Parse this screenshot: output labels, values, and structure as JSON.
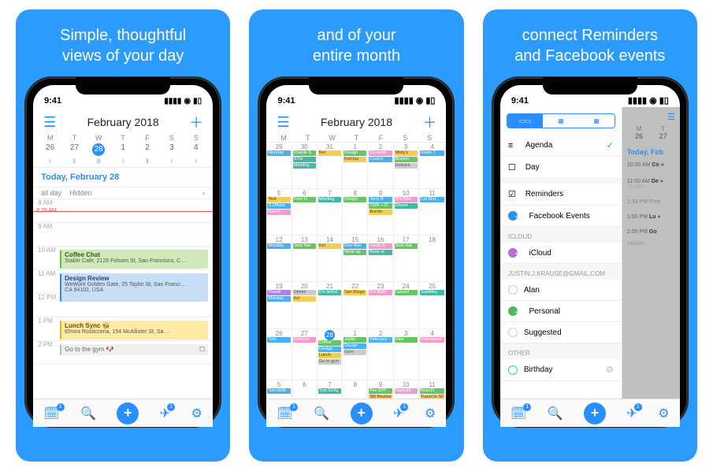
{
  "status": {
    "time": "9:41"
  },
  "captions": {
    "p1l1": "Simple, thoughtful",
    "p1l2": "views of your day",
    "p2l1": "and of your",
    "p2l2": "entire month",
    "p3l1": "connect Reminders",
    "p3l2": "and Facebook events"
  },
  "header": {
    "title": "February 2018",
    "weekdays": [
      "M",
      "T",
      "W",
      "T",
      "F",
      "S",
      "S"
    ],
    "daynums": [
      "26",
      "27",
      "28",
      "1",
      "2",
      "3",
      "4"
    ]
  },
  "day": {
    "today_label": "Today,",
    "today_date": "February 28",
    "allday_label": "all day",
    "allday_value": "Hidden",
    "hours": [
      "8 AM",
      "9 AM",
      "10 AM",
      "11 AM",
      "12 PM",
      "1 PM",
      "2 PM"
    ],
    "nowtime": "8:29 AM",
    "events": {
      "coffee": {
        "title": "Coffee Chat",
        "loc": "Stable Cafe, 2128 Folsom St, San Francisco, C…"
      },
      "design": {
        "title": "Design Review",
        "loc": "WeWork Golden Gate, 25 Taylor St, San Franci…"
      },
      "design2": "CA 94102, USA",
      "lunch": {
        "title": "Lunch Sync 🐝",
        "loc": "Elmira Rosticceria, 154 McAllister St, Sa…"
      },
      "gym": "Go to the gym 🐶"
    }
  },
  "month": {
    "weeks": [
      {
        "days": [
          "29",
          "30",
          "31",
          "1",
          "2",
          "3",
          "4"
        ]
      },
      {
        "days": [
          "5",
          "6",
          "7",
          "8",
          "9",
          "10",
          "11"
        ]
      },
      {
        "days": [
          "12",
          "13",
          "14",
          "15",
          "16",
          "17",
          "18"
        ]
      },
      {
        "days": [
          "19",
          "20",
          "21",
          "22",
          "23",
          "24",
          "25"
        ]
      },
      {
        "days": [
          "26",
          "27",
          "28",
          "1",
          "2",
          "3",
          "4"
        ]
      },
      {
        "days": [
          "5",
          "6",
          "7",
          "8",
          "9",
          "10",
          "11"
        ]
      }
    ],
    "sample_chips": {
      "c1": "Monday",
      "c2": "Charlie S",
      "c3": "Dinner",
      "c4": "Meeting",
      "c5": "Design",
      "c6": "Jerry B",
      "c7": "Brunch",
      "c8": "Lunch",
      "c9": "Coffee",
      "c10": "February",
      "c11": "Hike",
      "c12": "Free Agent",
      "c13": "TGIF + D",
      "c14": "Team Offsite",
      "c15": "Burrito",
      "c16": "SR Review",
      "c17": "Pre-SVP",
      "c18": "Book of",
      "c19": "Lunar N",
      "c20": "Justin T",
      "c21": "Daylight",
      "c22": "Subtitles",
      "c23": "Lunch!!",
      "c24": "Travel to SF",
      "c25": "San Diego"
    }
  },
  "drawer": {
    "agenda": "Agenda",
    "day": "Day",
    "reminders": "Reminders",
    "fb": "Facebook Events",
    "sect_icloud": "ICLOUD",
    "icloud": "iCloud",
    "sect_account": "JUSTIN.J.KRAUSE@GMAIL.COM",
    "alan": "Alan",
    "personal": "Personal",
    "suggested": "Suggested",
    "sect_other": "OTHER",
    "birthday": "Birthday"
  },
  "bg_day": {
    "daterow": [
      "M",
      "T"
    ],
    "daynums": [
      "26",
      "27"
    ],
    "today_lbl": "Today, Feb",
    "r1t": "10:00 AM",
    "r1": "Co",
    "r2t": "11:00 AM",
    "r2": "De",
    "r2d": "1h 30m",
    "r3t": "1:30 PM",
    "r3": "Free",
    "r4t": "1:00 PM",
    "r4": "Lu",
    "r5t": "2:00 PM",
    "r5": "Go",
    "r6": "Hidden"
  }
}
